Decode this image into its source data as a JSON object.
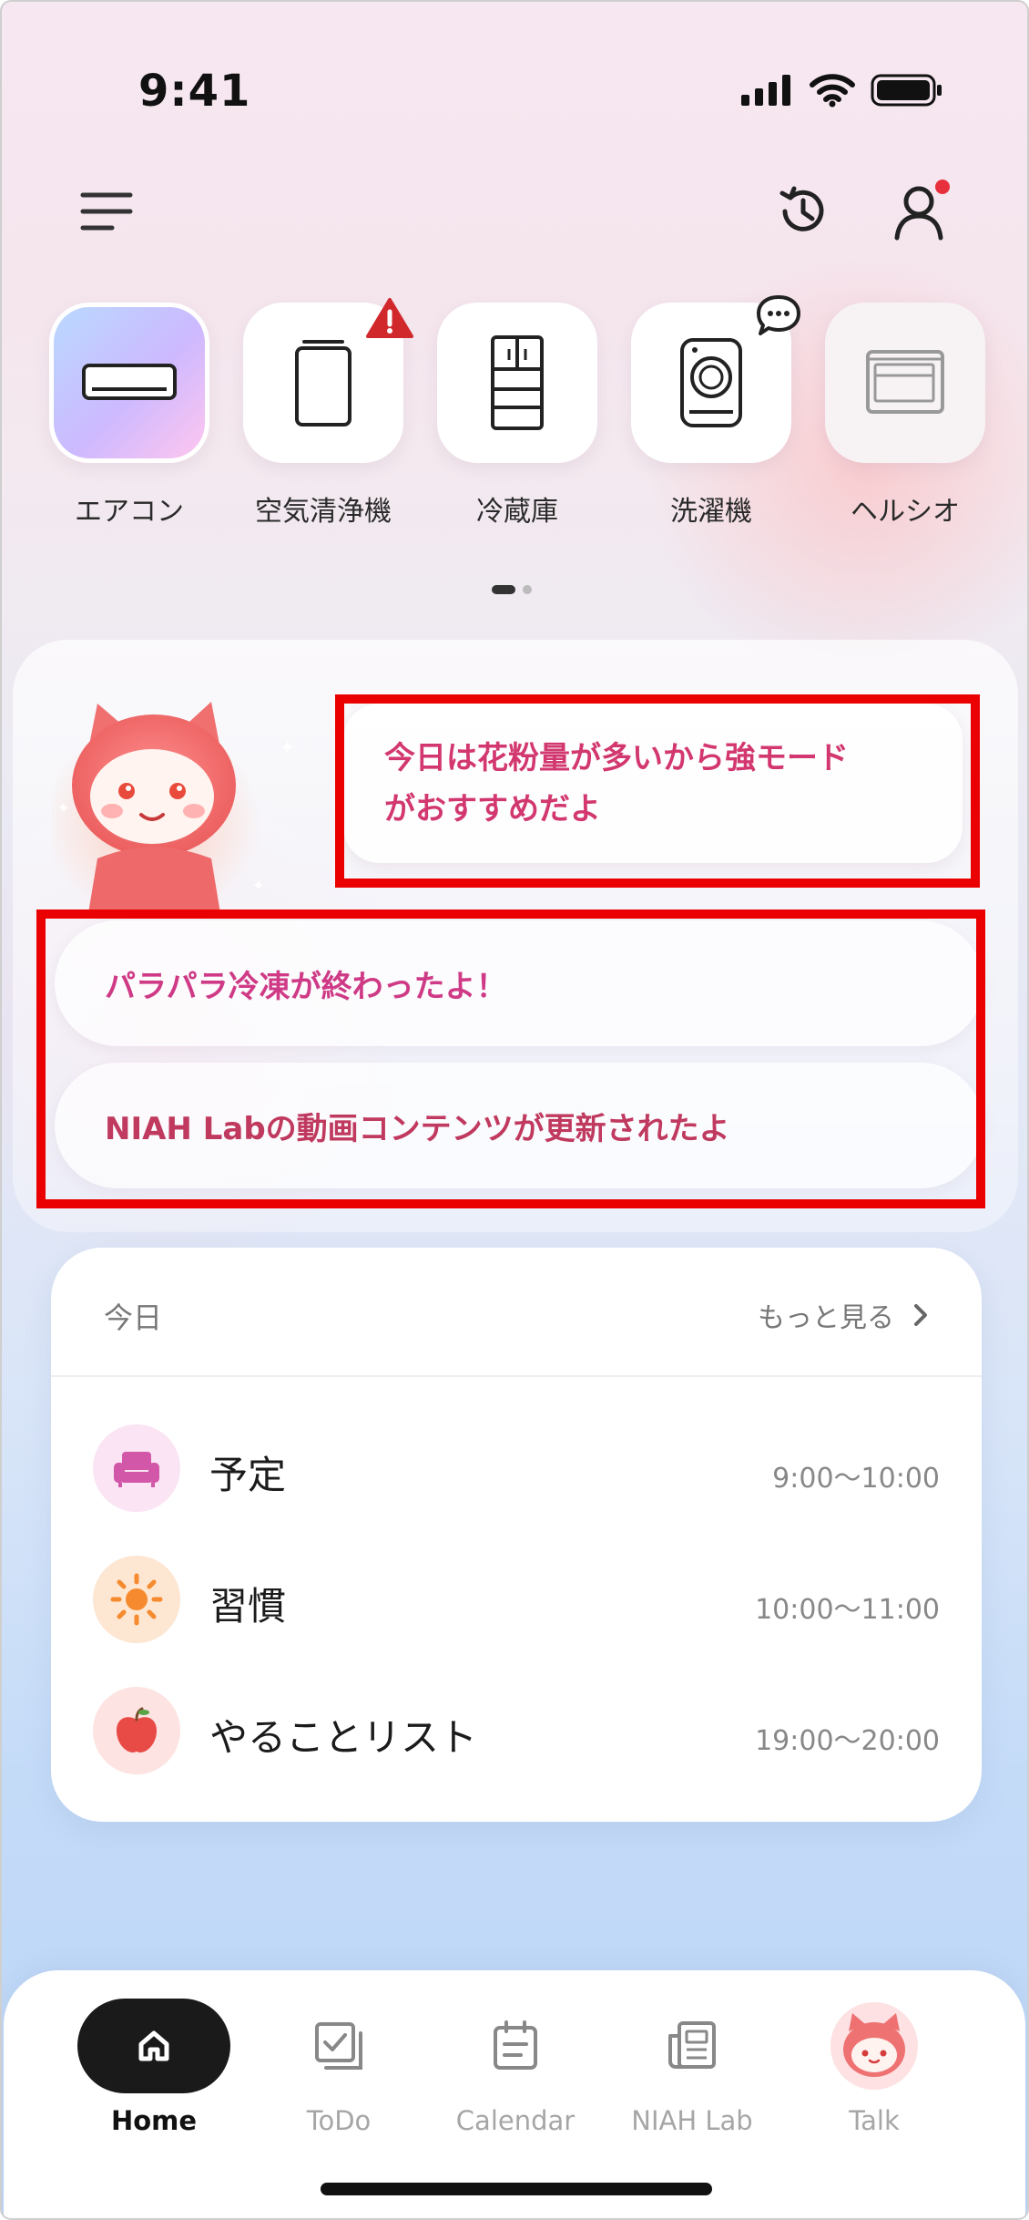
{
  "status_bar": {
    "time": "9:41"
  },
  "header": {
    "menu_icon": "hamburger-menu-icon",
    "history_icon": "history-icon",
    "profile_icon": "person-icon",
    "profile_badge_color": "#e8303c"
  },
  "appliances": [
    {
      "label": "エアコン",
      "icon": "air-conditioner-icon",
      "selected": true
    },
    {
      "label": "空気清浄機",
      "icon": "air-purifier-icon",
      "badge": "warning"
    },
    {
      "label": "冷蔵庫",
      "icon": "refrigerator-icon"
    },
    {
      "label": "洗濯機",
      "icon": "washing-machine-icon",
      "badge": "chat"
    },
    {
      "label": "ヘルシオ",
      "icon": "microwave-oven-icon"
    }
  ],
  "pager": {
    "pages": 2,
    "current": 1
  },
  "assistant": {
    "bubble_lines": [
      "今日は花粉量が多いから強モード",
      "がおすすめだよ"
    ],
    "notices": [
      "パラパラ冷凍が終わったよ！",
      "NIAH Labの動画コンテンツが更新されたよ"
    ]
  },
  "today": {
    "title": "今日",
    "more_label": "もっと見る",
    "rows": [
      {
        "label": "予定",
        "time": "9:00〜10:00",
        "icon": "sofa-icon",
        "icon_bg": "#fbe4f3",
        "icon_color": "#d257a8"
      },
      {
        "label": "習慣",
        "time": "10:00〜11:00",
        "icon": "sun-icon",
        "icon_bg": "#fde6d2",
        "icon_color": "#f58a2e"
      },
      {
        "label": "やることリスト",
        "time": "19:00〜20:00",
        "icon": "apple-icon",
        "icon_bg": "#fde3e1",
        "icon_color": "#e84a45"
      }
    ]
  },
  "tabs": [
    {
      "label": "Home",
      "icon": "home-icon",
      "active": true
    },
    {
      "label": "ToDo",
      "icon": "todo-icon"
    },
    {
      "label": "Calendar",
      "icon": "calendar-icon"
    },
    {
      "label": "NIAH Lab",
      "icon": "news-icon"
    },
    {
      "label": "Talk",
      "icon": "mascot-talk-icon"
    }
  ],
  "colors": {
    "accent_pink": "#d2386f",
    "highlight_box": "#ea0000",
    "tab_active": "#111111",
    "tab_inactive": "#a6a6a6"
  }
}
